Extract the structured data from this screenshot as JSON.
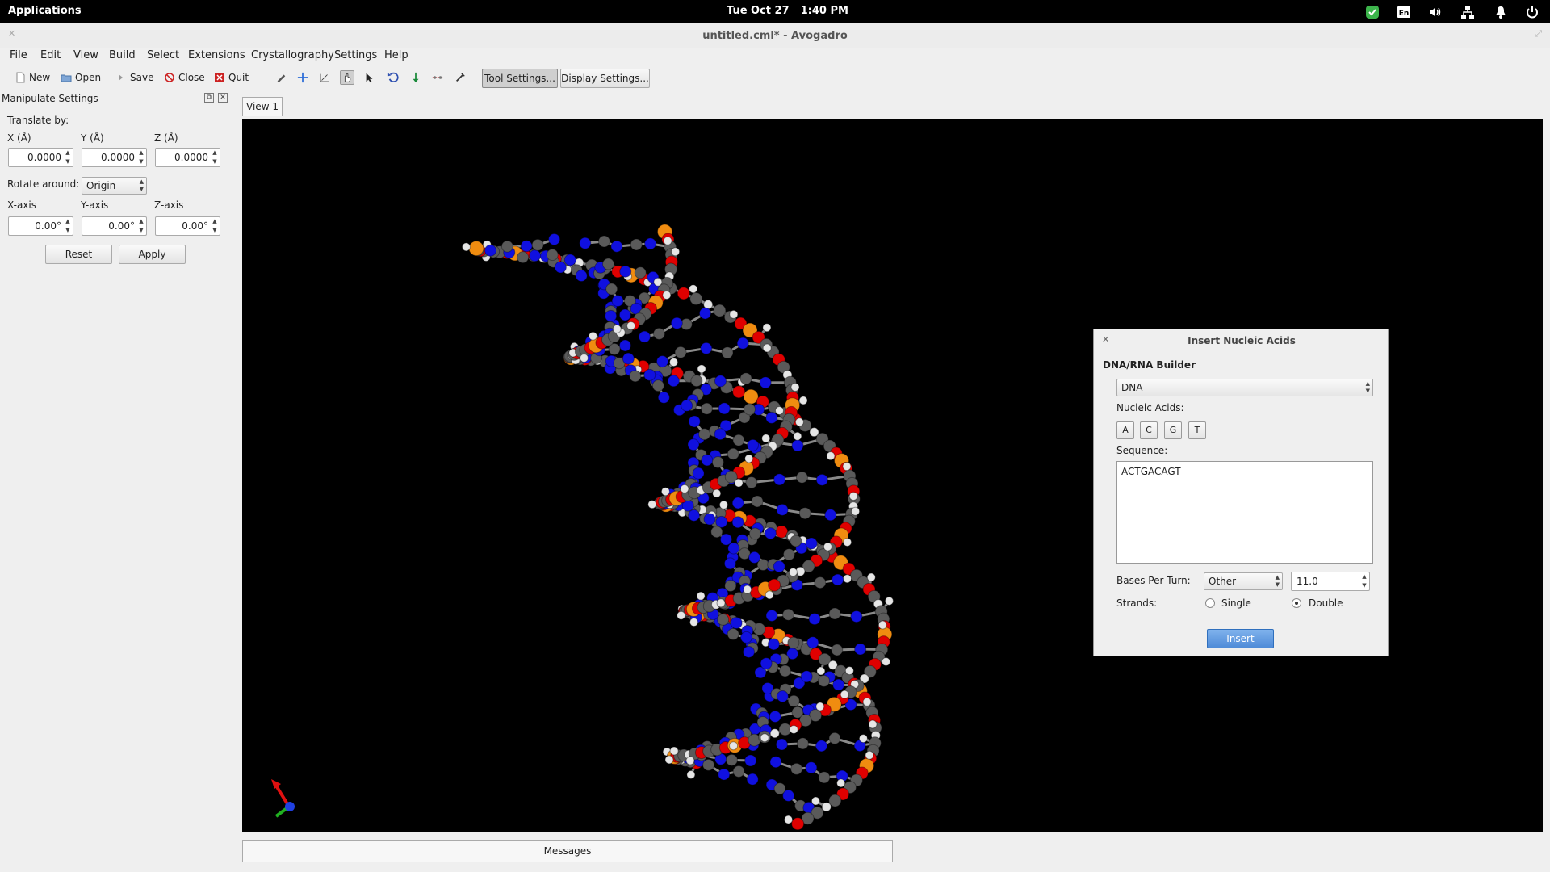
{
  "system_bar": {
    "applications_label": "Applications",
    "date": "Tue Oct 27",
    "time": "1:40 PM",
    "keyboard_layout": "En",
    "icons": [
      "check-shield-icon",
      "keyboard-layout-icon",
      "volume-icon",
      "network-icon",
      "notifications-bell-icon",
      "power-icon"
    ]
  },
  "window": {
    "title": "untitled.cml* - Avogadro"
  },
  "menubar": {
    "items": [
      "File",
      "Edit",
      "View",
      "Build",
      "Select",
      "Extensions",
      "Crystallography",
      "Settings",
      "Help"
    ]
  },
  "toolbar": {
    "new_label": "New",
    "open_label": "Open",
    "save_label": "Save",
    "close_label": "Close",
    "quit_label": "Quit",
    "tool_settings_label": "Tool Settings...",
    "display_settings_label": "Display Settings...",
    "tools": [
      "draw-tool-icon",
      "navigate-tool-icon",
      "measure-tool-icon",
      "manipulate-tool-icon",
      "select-tool-icon",
      "rotate-tool-icon",
      "align-tool-icon",
      "bond-centric-tool-icon",
      "auto-optimize-tool-icon"
    ]
  },
  "manipulate": {
    "title": "Manipulate Settings",
    "translate_by_label": "Translate by:",
    "x_label": "X (Å)",
    "y_label": "Y (Å)",
    "z_label": "Z (Å)",
    "x_value": "0.0000",
    "y_value": "0.0000",
    "z_value": "0.0000",
    "rotate_around_label": "Rotate around:",
    "rotate_around_value": "Origin",
    "x_axis_label": "X-axis",
    "y_axis_label": "Y-axis",
    "z_axis_label": "Z-axis",
    "x_axis_value": "0.00°",
    "y_axis_value": "0.00°",
    "z_axis_value": "0.00°",
    "reset_label": "Reset",
    "apply_label": "Apply"
  },
  "view": {
    "tab_label": "View 1",
    "messages_label": "Messages"
  },
  "dialog": {
    "title": "Insert Nucleic Acids",
    "section_label": "DNA/RNA Builder",
    "type_value": "DNA",
    "nucleic_acids_label": "Nucleic Acids:",
    "bases": [
      "A",
      "C",
      "G",
      "T"
    ],
    "sequence_label": "Sequence:",
    "sequence_value": "ACTGACAGT",
    "bases_per_turn_label": "Bases Per Turn:",
    "bases_per_turn_mode": "Other",
    "bases_per_turn_value": "11.0",
    "strands_label": "Strands:",
    "single_label": "Single",
    "double_label": "Double",
    "selected_strand": "Double",
    "insert_label": "Insert"
  },
  "colors": {
    "carbon": "#5a5a5a",
    "hydrogen": "#e6e6e6",
    "oxygen": "#e00000",
    "nitrogen": "#1010e0",
    "phosphorus": "#f08c10",
    "viewport_background": "#000000",
    "insert_button": "#5a94dc"
  }
}
